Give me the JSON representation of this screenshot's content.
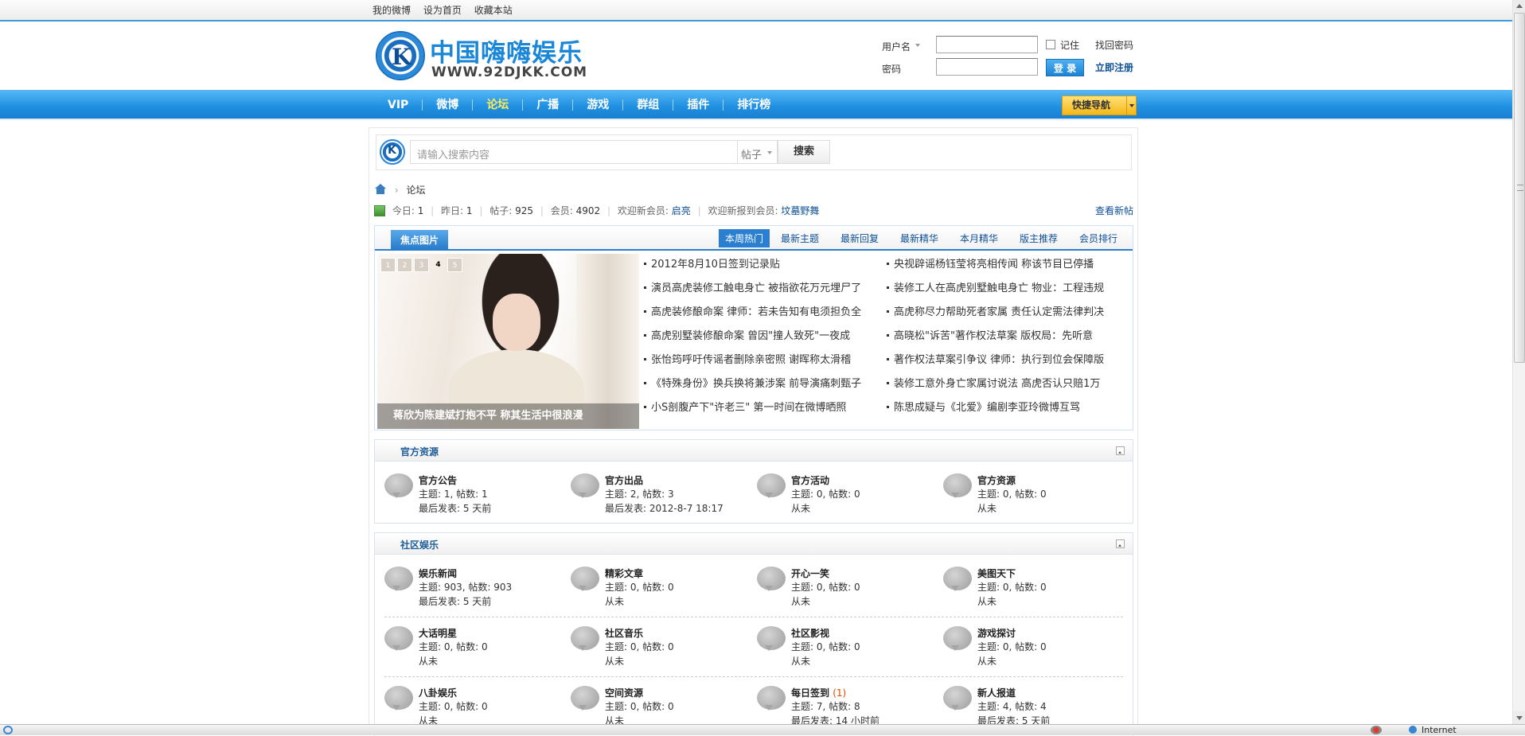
{
  "topbar": {
    "links": [
      "我的微博",
      "设为首页",
      "收藏本站"
    ]
  },
  "logo": {
    "title": "中国嗨嗨娱乐",
    "url_text": "WWW.92DJKK.COM",
    "mark": "K"
  },
  "login": {
    "username_label": "用户名",
    "password_label": "密码",
    "remember_label": "记住",
    "forgot_label": "找回密码",
    "login_button": "登 录",
    "register_label": "立即注册"
  },
  "nav": {
    "items": [
      {
        "label": "VIP",
        "active": false
      },
      {
        "label": "微博",
        "active": false
      },
      {
        "label": "论坛",
        "active": true
      },
      {
        "label": "广播",
        "active": false
      },
      {
        "label": "游戏",
        "active": false
      },
      {
        "label": "群组",
        "active": false
      },
      {
        "label": "插件",
        "active": false
      },
      {
        "label": "排行榜",
        "active": false
      }
    ],
    "quick_nav": "快捷导航"
  },
  "search": {
    "placeholder": "请输入搜索内容",
    "type": "帖子",
    "button": "搜索"
  },
  "breadcrumb": {
    "current": "论坛"
  },
  "stats": {
    "today_label": "今日:",
    "today": "1",
    "yesterday_label": "昨日:",
    "yesterday": "1",
    "posts_label": "帖子:",
    "posts": "925",
    "members_label": "会员:",
    "members": "4902",
    "welcome_label": "欢迎新会员:",
    "welcome_user": "启亮",
    "newest_label": "欢迎新报到会员:",
    "newest_user": "坟墓野舞",
    "view_new": "查看新帖"
  },
  "focus": {
    "title": "焦点图片",
    "tabs": [
      "本周热门",
      "最新主题",
      "最新回复",
      "最新精华",
      "本月精华",
      "版主推荐",
      "会员排行"
    ],
    "active_tab": "本周热门",
    "slide_numbers": [
      "1",
      "2",
      "3",
      "4",
      "5"
    ],
    "current_slide": "4",
    "caption": "蒋欣为陈建斌打抱不平 称其生活中很浪漫",
    "col1": [
      "2012年8月10日签到记录贴",
      "演员高虎装修工触电身亡 被指欲花万元埋尸了",
      "高虎装修酿命案 律师：若未告知有电须担负全",
      "高虎别墅装修酿命案 曾因\"撞人致死\"一夜成",
      "张怡筠呼吁传谣者删除亲密照 谢晖称太滑稽",
      "《特殊身份》换兵换将兼涉案 前导演痛刺甄子",
      "小S剖腹产下\"许老三\" 第一时间在微博晒照"
    ],
    "col2": [
      "央视辟谣杨钰莹将亮相传闻 称该节目已停播",
      "装修工人在高虎别墅触电身亡 物业：工程违规",
      "高虎称尽力帮助死者家属 责任认定需法律判决",
      "高晓松\"诉苦\"著作权法草案 版权局：先听意",
      "著作权法草案引争议 律师：执行到位会保障版",
      "装修工意外身亡家属讨说法 高虎否认只赔1万",
      "陈思成疑与《北爱》编剧李亚玲微博互骂"
    ]
  },
  "categories": [
    {
      "title": "官方资源",
      "rows": [
        [
          {
            "name": "官方公告",
            "today": "",
            "stats": "主题: 1, 帖数: 1",
            "last": "最后发表: 5 天前"
          },
          {
            "name": "官方出品",
            "today": "",
            "stats": "主题: 2, 帖数: 3",
            "last": "最后发表: 2012-8-7 18:17"
          },
          {
            "name": "官方活动",
            "today": "",
            "stats": "主题: 0, 帖数: 0",
            "last": "从未"
          },
          {
            "name": "官方资源",
            "today": "",
            "stats": "主题: 0, 帖数: 0",
            "last": "从未"
          }
        ]
      ]
    },
    {
      "title": "社区娱乐",
      "rows": [
        [
          {
            "name": "娱乐新闻",
            "today": "",
            "stats": "主题: 903, 帖数: 903",
            "last": "最后发表: 5 天前"
          },
          {
            "name": "精彩文章",
            "today": "",
            "stats": "主题: 0, 帖数: 0",
            "last": "从未"
          },
          {
            "name": "开心一笑",
            "today": "",
            "stats": "主题: 0, 帖数: 0",
            "last": "从未"
          },
          {
            "name": "美图天下",
            "today": "",
            "stats": "主题: 0, 帖数: 0",
            "last": "从未"
          }
        ],
        [
          {
            "name": "大话明星",
            "today": "",
            "stats": "主题: 0, 帖数: 0",
            "last": "从未"
          },
          {
            "name": "社区音乐",
            "today": "",
            "stats": "主题: 0, 帖数: 0",
            "last": "从未"
          },
          {
            "name": "社区影视",
            "today": "",
            "stats": "主题: 0, 帖数: 0",
            "last": "从未"
          },
          {
            "name": "游戏探讨",
            "today": "",
            "stats": "主题: 0, 帖数: 0",
            "last": "从未"
          }
        ],
        [
          {
            "name": "八卦娱乐",
            "today": "",
            "stats": "主题: 0, 帖数: 0",
            "last": "从未"
          },
          {
            "name": "空间资源",
            "today": "",
            "stats": "主题: 0, 帖数: 0",
            "last": "从未"
          },
          {
            "name": "每日签到",
            "today": "(1)",
            "stats": "主题: 7, 帖数: 8",
            "last": "最后发表: 14 小时前"
          },
          {
            "name": "新人报道",
            "today": "",
            "stats": "主题: 4, 帖数: 4",
            "last": "最后发表: 5 天前"
          }
        ]
      ]
    }
  ],
  "statusbar": {
    "zone": "Internet"
  }
}
